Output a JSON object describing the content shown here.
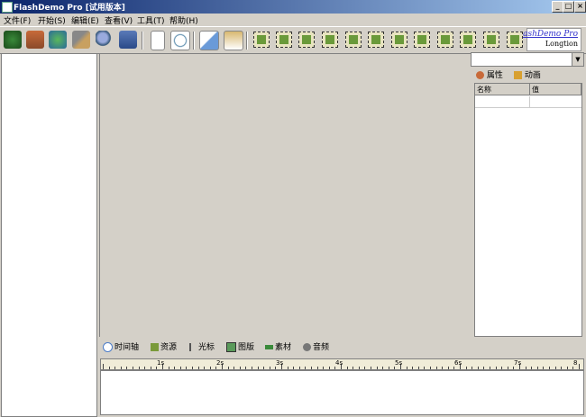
{
  "window": {
    "title": "FlashDemo Pro [试用版本]",
    "minimize_glyph": "_",
    "maximize_glyph": "□",
    "close_glyph": "×"
  },
  "menu": [
    "文件(F)",
    "开始(S)",
    "编辑(E)",
    "查看(V)",
    "工具(T)",
    "帮助(H)"
  ],
  "toolbar": {
    "buttons": [
      "record-icon",
      "home-icon",
      "globe-icon",
      "tools-icon",
      "search-icon",
      "export-icon",
      "new-page-icon",
      "preview-icon",
      "copy-icon",
      "paste-icon"
    ],
    "insert_buttons": [
      "frame-icon",
      "window-icon",
      "region-icon",
      "note-icon",
      "image-icon",
      "text-icon",
      "title-icon",
      "button-icon",
      "highlight-icon",
      "cursor-icon",
      "sound-icon"
    ]
  },
  "logo": {
    "line1": "ashDemo Pro",
    "line2": "Longtion"
  },
  "properties": {
    "tabs": [
      {
        "label": "属性",
        "icon": "gear-icon"
      },
      {
        "label": "动画",
        "icon": "film-icon"
      }
    ],
    "columns": [
      "名称",
      "值"
    ]
  },
  "bottom_tabs": [
    {
      "label": "时间轴",
      "icon": "clock-icon",
      "color": "#4a7bc8"
    },
    {
      "label": "资源",
      "icon": "resource-icon",
      "color": "#7a9a3a"
    },
    {
      "label": "光标",
      "icon": "cursor-icon",
      "color": "#555555"
    },
    {
      "label": "图版",
      "icon": "image-icon",
      "color": "#5a9a5a"
    },
    {
      "label": "素材",
      "icon": "material-icon",
      "color": "#3a8a3a"
    },
    {
      "label": "音频",
      "icon": "audio-icon",
      "color": "#777777"
    }
  ],
  "ruler": {
    "labels": [
      "1s",
      "2s",
      "3s",
      "4s",
      "5s",
      "6s",
      "7s",
      "8"
    ]
  }
}
